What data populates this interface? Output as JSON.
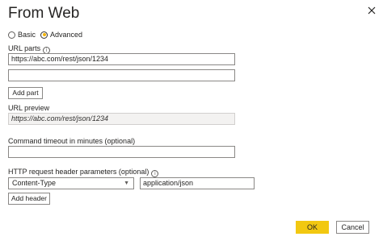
{
  "dialog": {
    "title": "From Web"
  },
  "mode": {
    "options": [
      {
        "label": "Basic",
        "selected": false
      },
      {
        "label": "Advanced",
        "selected": true
      }
    ]
  },
  "url_parts": {
    "label": "URL parts",
    "info_icon": "info-icon",
    "parts": [
      "https://abc.com/rest/json/1234",
      ""
    ],
    "add_part_label": "Add part"
  },
  "url_preview": {
    "label": "URL preview",
    "value": "https://abc.com/rest/json/1234"
  },
  "timeout": {
    "label": "Command timeout in minutes (optional)",
    "value": ""
  },
  "headers": {
    "label": "HTTP request header parameters (optional)",
    "info_icon": "info-icon",
    "name_selected": "Content-Type",
    "value": "application/json",
    "add_header_label": "Add header"
  },
  "footer": {
    "ok_label": "OK",
    "cancel_label": "Cancel"
  },
  "colors": {
    "accent": "#f2c811",
    "border": "#8a8886",
    "disabled_bg": "#f3f2f1"
  }
}
